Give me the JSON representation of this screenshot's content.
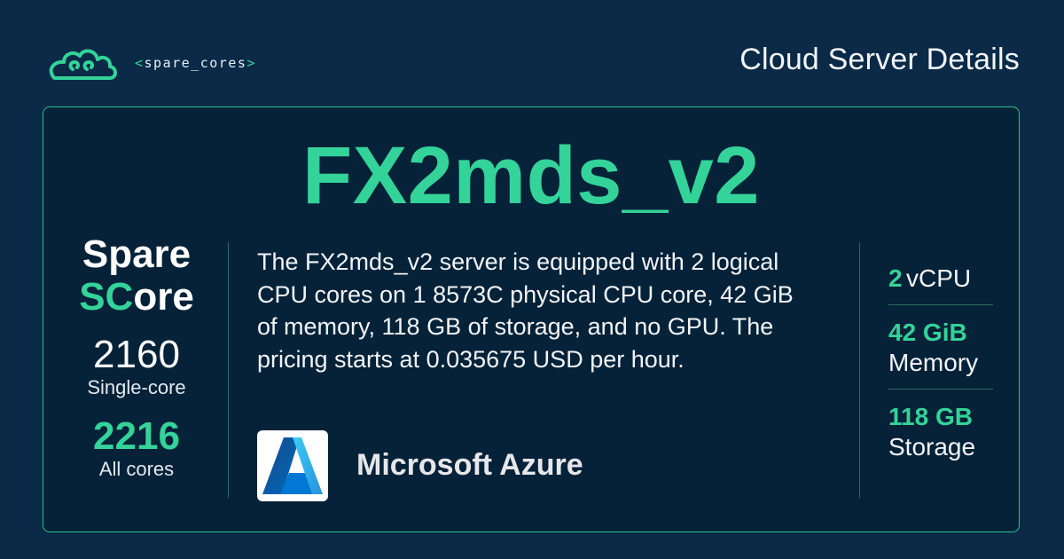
{
  "brand": {
    "open": "<",
    "name": "spare_cores",
    "close": ">"
  },
  "header": {
    "title": "Cloud Server Details"
  },
  "server": {
    "name": "FX2mds_v2",
    "description": "The FX2mds_v2 server is equipped with 2 logical CPU cores on 1 8573C physical CPU core, 42 GiB of memory, 118 GB of storage, and no GPU. The pricing starts at 0.035675 USD per hour."
  },
  "score": {
    "title_line1": "Spare",
    "title_sc": "SC",
    "title_rest": "ore",
    "single_value": "2160",
    "single_label": "Single-core",
    "all_value": "2216",
    "all_label": "All cores"
  },
  "provider": {
    "name": "Microsoft Azure",
    "icon": "azure-logo"
  },
  "specs": {
    "vcpu_value": "2",
    "vcpu_label": "vCPU",
    "memory_value": "42 GiB",
    "memory_label": "Memory",
    "storage_value": "118 GB",
    "storage_label": "Storage"
  },
  "colors": {
    "background": "#0a2a47",
    "card": "#062238",
    "accent": "#34d399",
    "text": "#ffffff"
  }
}
